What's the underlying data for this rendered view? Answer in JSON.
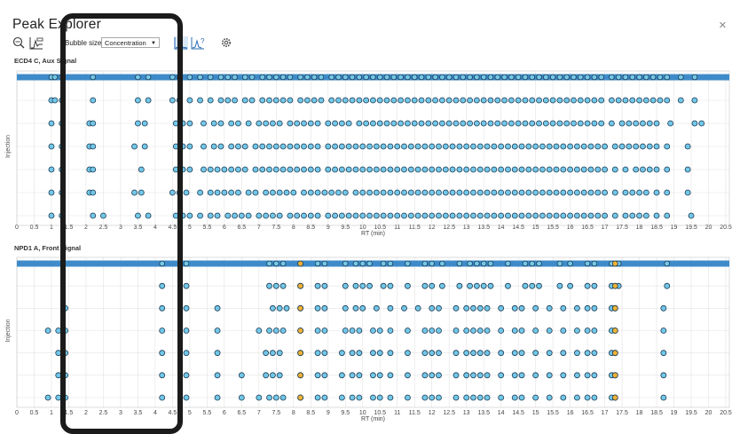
{
  "window": {
    "title": "Peak Explorer",
    "close_symbol": "×"
  },
  "toolbar": {
    "bubble_size_label": "Bubble size",
    "bubble_size_value": "Concentration",
    "icons": [
      "zoom-fit-icon",
      "chromatogram-icon",
      "peak-graph-icon",
      "peak-help-icon",
      "settings-icon"
    ]
  },
  "colors": {
    "point": "#73c7e8",
    "point_stroke": "#1a3c55",
    "highlight_row": "#3f8bc9",
    "special_point": "#f2b233",
    "grid": "#e3e3e3"
  },
  "chart_data": [
    {
      "type": "scatter",
      "title": "ECD4 C, Aux Signal",
      "xlabel": "RT (min)",
      "ylabel": "Injection",
      "xlim": [
        0,
        20.5
      ],
      "xticks": [
        "0",
        "0.5",
        "1",
        "1.5",
        "2",
        "2.5",
        "3",
        "3.5",
        "4",
        "4.5",
        "5",
        "5.5",
        "6",
        "6.5",
        "7",
        "7.5",
        "8",
        "8.5",
        "9",
        "9.5",
        "10",
        "10.5",
        "11",
        "11.5",
        "12",
        "12.5",
        "13",
        "13.5",
        "14",
        "14.5",
        "15",
        "15.5",
        "16",
        "16.5",
        "17",
        "17.5",
        "18",
        "18.5",
        "19",
        "19.5",
        "20",
        "20.5"
      ],
      "injections": 6,
      "highlighted_injection": 0,
      "series": [
        {
          "injection": 1,
          "rt": [
            1.0,
            1.1,
            1.3,
            2.2,
            3.5,
            3.8,
            4.5,
            4.7,
            5.0,
            5.3,
            5.6,
            5.9,
            6.1,
            6.3,
            6.6,
            6.8,
            7.1,
            7.3,
            7.5,
            7.7,
            7.9,
            8.2,
            8.4,
            8.6,
            8.8,
            9.1,
            9.3,
            9.5,
            9.7,
            9.9,
            10.1,
            10.3,
            10.5,
            10.7,
            10.9,
            11.1,
            11.3,
            11.5,
            11.7,
            11.9,
            12.1,
            12.3,
            12.5,
            12.7,
            12.9,
            13.1,
            13.3,
            13.5,
            13.7,
            13.9,
            14.1,
            14.3,
            14.5,
            14.7,
            14.9,
            15.1,
            15.3,
            15.5,
            15.7,
            15.9,
            16.1,
            16.3,
            16.5,
            16.7,
            16.9,
            17.2,
            17.4,
            17.6,
            17.8,
            18.0,
            18.2,
            18.4,
            18.6,
            18.8,
            19.2,
            19.6
          ]
        },
        {
          "injection": 2,
          "rt": [
            1.0,
            1.3,
            2.1,
            2.2,
            3.5,
            3.7,
            4.6,
            4.8,
            5.0,
            5.4,
            5.7,
            5.9,
            6.2,
            6.4,
            6.7,
            7.0,
            7.2,
            7.4,
            7.6,
            7.9,
            8.1,
            8.3,
            8.5,
            8.7,
            9.0,
            9.2,
            9.4,
            9.6,
            9.9,
            10.1,
            10.3,
            10.5,
            10.7,
            10.9,
            11.1,
            11.3,
            11.5,
            11.7,
            11.9,
            12.1,
            12.3,
            12.5,
            12.7,
            12.9,
            13.1,
            13.3,
            13.5,
            13.7,
            13.9,
            14.1,
            14.3,
            14.5,
            14.7,
            14.9,
            15.1,
            15.3,
            15.5,
            15.7,
            15.9,
            16.1,
            16.3,
            16.5,
            16.7,
            16.9,
            17.2,
            17.5,
            17.7,
            17.9,
            18.1,
            18.3,
            18.5,
            18.9,
            19.6,
            19.8
          ]
        },
        {
          "injection": 3,
          "rt": [
            1.0,
            1.3,
            2.1,
            2.2,
            3.4,
            3.7,
            4.6,
            4.8,
            5.0,
            5.4,
            5.7,
            5.9,
            6.2,
            6.4,
            6.6,
            6.9,
            7.1,
            7.3,
            7.5,
            7.7,
            7.9,
            8.1,
            8.3,
            8.5,
            8.7,
            9.0,
            9.2,
            9.4,
            9.6,
            9.8,
            10.0,
            10.2,
            10.4,
            10.6,
            10.8,
            11.0,
            11.2,
            11.4,
            11.6,
            11.8,
            12.0,
            12.2,
            12.4,
            12.6,
            12.8,
            13.0,
            13.2,
            13.4,
            13.6,
            13.8,
            14.0,
            14.2,
            14.4,
            14.6,
            14.8,
            15.0,
            15.2,
            15.4,
            15.6,
            15.8,
            16.0,
            16.2,
            16.4,
            16.6,
            16.8,
            17.0,
            17.3,
            17.5,
            17.7,
            17.9,
            18.1,
            18.3,
            18.5,
            18.8,
            19.4
          ]
        },
        {
          "injection": 4,
          "rt": [
            1.0,
            1.3,
            2.1,
            2.2,
            3.6,
            4.6,
            4.8,
            5.0,
            5.4,
            5.6,
            5.8,
            6.0,
            6.2,
            6.4,
            6.6,
            6.9,
            7.1,
            7.3,
            7.5,
            7.7,
            7.9,
            8.1,
            8.3,
            8.5,
            8.7,
            9.0,
            9.2,
            9.4,
            9.6,
            9.8,
            10.0,
            10.2,
            10.4,
            10.6,
            10.8,
            11.0,
            11.2,
            11.4,
            11.6,
            11.8,
            12.0,
            12.2,
            12.4,
            12.6,
            12.8,
            13.0,
            13.2,
            13.4,
            13.6,
            13.8,
            14.0,
            14.2,
            14.4,
            14.6,
            14.8,
            15.0,
            15.2,
            15.4,
            15.6,
            15.8,
            16.0,
            16.2,
            16.4,
            16.6,
            16.8,
            17.0,
            17.3,
            17.6,
            17.9,
            18.1,
            18.3,
            18.5,
            18.8,
            19.4
          ]
        },
        {
          "injection": 5,
          "rt": [
            1.0,
            1.3,
            2.1,
            2.2,
            3.4,
            3.6,
            4.5,
            4.7,
            4.9,
            5.3,
            5.6,
            5.8,
            6.0,
            6.2,
            6.4,
            6.7,
            6.9,
            7.2,
            7.4,
            7.6,
            7.8,
            8.0,
            8.3,
            8.5,
            8.7,
            8.9,
            9.1,
            9.3,
            9.5,
            9.8,
            10.0,
            10.2,
            10.4,
            10.6,
            10.8,
            11.0,
            11.2,
            11.4,
            11.6,
            11.8,
            12.0,
            12.2,
            12.4,
            12.6,
            12.8,
            13.0,
            13.2,
            13.4,
            13.6,
            13.8,
            14.0,
            14.2,
            14.4,
            14.6,
            14.8,
            15.0,
            15.2,
            15.4,
            15.6,
            15.8,
            16.0,
            16.2,
            16.4,
            16.6,
            16.8,
            17.0,
            17.3,
            17.6,
            17.8,
            18.0,
            18.2,
            18.5,
            18.8,
            19.4
          ]
        },
        {
          "injection": 6,
          "rt": [
            1.0,
            1.3,
            2.2,
            2.5,
            3.5,
            3.8,
            4.6,
            4.8,
            5.0,
            5.3,
            5.6,
            5.8,
            6.1,
            6.3,
            6.5,
            6.7,
            7.0,
            7.2,
            7.4,
            7.6,
            7.9,
            8.1,
            8.3,
            8.5,
            8.7,
            9.0,
            9.2,
            9.4,
            9.6,
            9.8,
            10.0,
            10.2,
            10.4,
            10.6,
            10.8,
            11.0,
            11.2,
            11.4,
            11.6,
            11.8,
            12.0,
            12.2,
            12.4,
            12.6,
            12.8,
            13.0,
            13.2,
            13.4,
            13.6,
            13.8,
            14.0,
            14.2,
            14.4,
            14.6,
            14.8,
            15.0,
            15.2,
            15.4,
            15.6,
            15.8,
            16.0,
            16.2,
            16.4,
            16.6,
            16.8,
            17.0,
            17.3,
            17.6,
            17.8,
            18.0,
            18.2,
            18.5,
            18.8,
            19.5
          ]
        }
      ],
      "special_points": []
    },
    {
      "type": "scatter",
      "title": "NPD1 A, Front Signal",
      "xlabel": "RT (min)",
      "ylabel": "Injection",
      "xlim": [
        0,
        20.5
      ],
      "xticks": [
        "0",
        "0.5",
        "1",
        "1.5",
        "2",
        "2.5",
        "3",
        "3.5",
        "4",
        "4.5",
        "5",
        "5.5",
        "6",
        "6.5",
        "7",
        "7.5",
        "8",
        "8.5",
        "9",
        "9.5",
        "10",
        "10.5",
        "11",
        "11.5",
        "12",
        "12.5",
        "13",
        "13.5",
        "14",
        "14.5",
        "15",
        "15.5",
        "16",
        "16.5",
        "17",
        "17.5",
        "18",
        "18.5",
        "19",
        "19.5",
        "20",
        "20.5"
      ],
      "injections": 6,
      "highlighted_injection": 0,
      "series": [
        {
          "injection": 1,
          "rt": [
            4.2,
            4.9,
            7.3,
            7.5,
            7.7,
            8.2,
            8.7,
            8.9,
            9.5,
            9.8,
            10.0,
            10.2,
            10.6,
            10.8,
            11.3,
            11.8,
            12.0,
            12.3,
            12.8,
            13.1,
            13.3,
            13.5,
            13.7,
            14.2,
            14.7,
            14.9,
            15.1,
            15.7,
            16.0,
            16.5,
            16.7,
            17.2,
            17.4,
            18.8
          ]
        },
        {
          "injection": 2,
          "rt": [
            1.4,
            4.2,
            4.9,
            5.8,
            7.4,
            7.6,
            7.8,
            8.2,
            8.7,
            8.9,
            9.5,
            9.8,
            10.0,
            10.4,
            10.8,
            11.2,
            11.6,
            12.0,
            12.2,
            12.7,
            13.0,
            13.2,
            13.4,
            13.6,
            14.0,
            14.4,
            14.6,
            15.0,
            15.4,
            15.8,
            16.2,
            16.5,
            16.7,
            17.2,
            17.3,
            18.7
          ]
        },
        {
          "injection": 3,
          "rt": [
            0.9,
            1.2,
            1.4,
            4.2,
            4.9,
            5.8,
            7.0,
            7.3,
            7.5,
            7.7,
            8.2,
            8.7,
            8.9,
            9.5,
            9.7,
            9.9,
            10.3,
            10.5,
            10.8,
            11.3,
            11.8,
            12.0,
            12.2,
            12.7,
            13.0,
            13.2,
            13.4,
            13.6,
            14.0,
            14.4,
            14.6,
            15.0,
            15.4,
            15.8,
            16.2,
            16.5,
            16.7,
            17.2,
            17.3,
            18.7
          ]
        },
        {
          "injection": 4,
          "rt": [
            1.2,
            1.4,
            4.2,
            4.9,
            5.8,
            7.2,
            7.4,
            7.6,
            8.2,
            8.7,
            8.9,
            9.4,
            9.7,
            9.9,
            10.3,
            10.5,
            10.8,
            11.3,
            11.8,
            12.0,
            12.2,
            12.7,
            13.0,
            13.2,
            13.4,
            13.6,
            14.0,
            14.4,
            14.6,
            15.0,
            15.4,
            15.8,
            16.2,
            16.5,
            16.7,
            17.2,
            17.3,
            18.7
          ]
        },
        {
          "injection": 5,
          "rt": [
            1.2,
            1.4,
            4.2,
            4.9,
            5.8,
            6.5,
            7.2,
            7.4,
            7.6,
            8.2,
            8.7,
            8.9,
            9.4,
            9.7,
            9.9,
            10.3,
            10.5,
            10.8,
            11.3,
            11.8,
            12.0,
            12.2,
            12.7,
            13.0,
            13.2,
            13.4,
            13.6,
            14.0,
            14.4,
            14.6,
            15.0,
            15.4,
            15.8,
            16.2,
            16.5,
            16.7,
            17.2,
            17.3,
            18.7
          ]
        },
        {
          "injection": 6,
          "rt": [
            0.9,
            1.2,
            1.4,
            4.2,
            4.9,
            5.8,
            6.5,
            7.0,
            7.3,
            7.5,
            7.7,
            8.2,
            8.7,
            8.9,
            9.4,
            9.7,
            9.9,
            10.3,
            10.5,
            10.8,
            11.3,
            11.8,
            12.0,
            12.2,
            12.7,
            13.0,
            13.2,
            13.4,
            13.6,
            14.0,
            14.4,
            14.6,
            15.0,
            15.4,
            15.8,
            16.2,
            16.5,
            16.7,
            17.2,
            17.3,
            18.7
          ]
        }
      ],
      "special_points": [
        {
          "injection": 0,
          "rt": 8.2
        },
        {
          "injection": 1,
          "rt": 8.2
        },
        {
          "injection": 2,
          "rt": 8.2
        },
        {
          "injection": 3,
          "rt": 8.2
        },
        {
          "injection": 4,
          "rt": 8.2
        },
        {
          "injection": 5,
          "rt": 8.2
        },
        {
          "injection": 6,
          "rt": 8.2
        },
        {
          "injection": 0,
          "rt": 17.3
        },
        {
          "injection": 1,
          "rt": 17.3
        },
        {
          "injection": 2,
          "rt": 17.3
        },
        {
          "injection": 3,
          "rt": 17.3
        },
        {
          "injection": 4,
          "rt": 17.3
        },
        {
          "injection": 5,
          "rt": 17.3
        },
        {
          "injection": 6,
          "rt": 17.3
        }
      ]
    }
  ]
}
